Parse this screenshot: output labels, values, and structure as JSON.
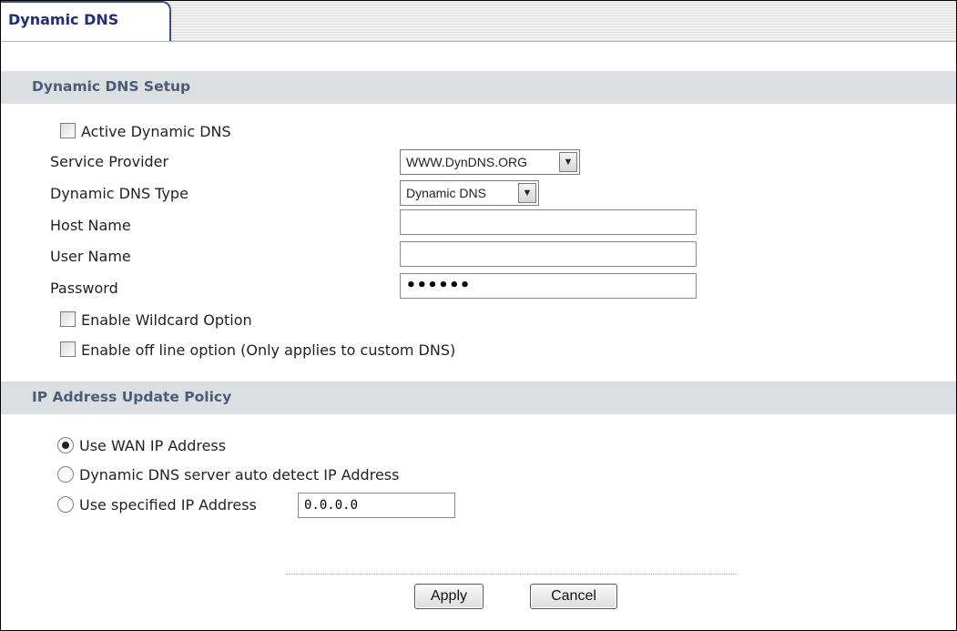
{
  "tab": {
    "label": "Dynamic DNS"
  },
  "setup": {
    "header": "Dynamic DNS Setup",
    "active_label": "Active Dynamic DNS",
    "service_provider": {
      "label": "Service Provider",
      "value": "WWW.DynDNS.ORG"
    },
    "ddns_type": {
      "label": "Dynamic DNS Type",
      "value": "Dynamic DNS"
    },
    "host_name": {
      "label": "Host Name",
      "value": ""
    },
    "user_name": {
      "label": "User Name",
      "value": ""
    },
    "password": {
      "label": "Password",
      "value": "••••••"
    },
    "wildcard_label": "Enable Wildcard Option",
    "offline_label": "Enable off line option (Only applies to custom DNS)"
  },
  "policy": {
    "header": "IP Address Update Policy",
    "options": [
      {
        "label": "Use WAN IP Address",
        "selected": true
      },
      {
        "label": "Dynamic DNS server auto detect IP Address",
        "selected": false
      },
      {
        "label": "Use specified IP Address",
        "selected": false
      }
    ],
    "specified_ip": "0.0.0.0"
  },
  "buttons": {
    "apply": "Apply",
    "cancel": "Cancel"
  },
  "icons": {
    "select_arrow": "chevron-down-icon"
  },
  "colors": {
    "tab_text": "#1f2f7a",
    "section_header_bg": "#dcdfe2",
    "section_header_text": "#4e5b76"
  }
}
